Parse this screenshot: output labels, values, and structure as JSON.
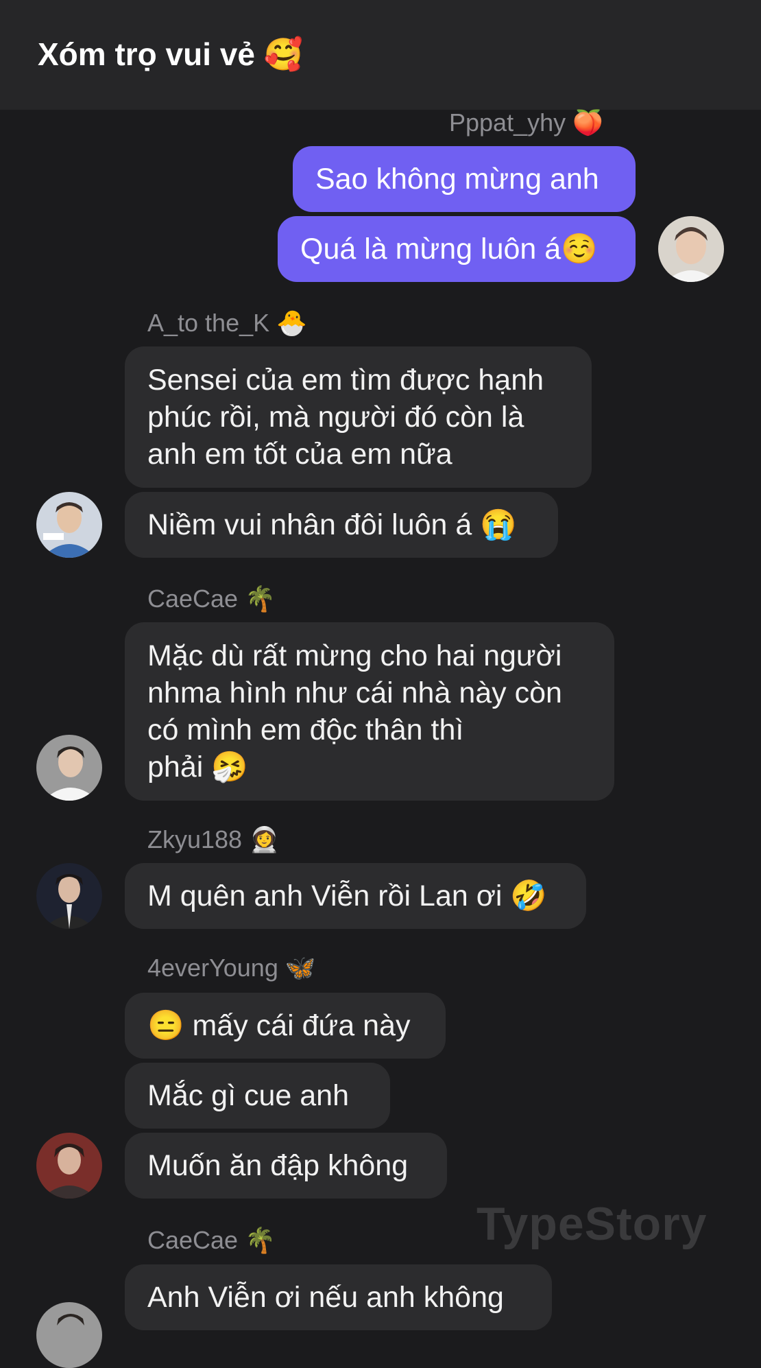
{
  "header": {
    "title": "Xóm trọ vui vẻ",
    "title_emoji": "🥰"
  },
  "messages": [
    {
      "sender": "Pppat_yhy",
      "sender_emoji": "🍑",
      "bubbles": [
        "Sao không mừng anh",
        "Quá là mừng luôn á☺️"
      ]
    },
    {
      "sender": "A_to the_K",
      "sender_emoji": "🐣",
      "bubbles": [
        "Sensei của em tìm được hạnh\nphúc rồi, mà người đó còn là\nanh em tốt của em nữa",
        "Niềm vui nhân đôi luôn á 😭"
      ]
    },
    {
      "sender": "CaeCae",
      "sender_emoji": "🌴",
      "bubbles": [
        "Mặc dù rất mừng cho hai người\nnhma hình như cái nhà này còn\ncó mình em độc thân thì\nphải 🤧"
      ]
    },
    {
      "sender": "Zkyu188",
      "sender_emoji": "👩‍🚀",
      "bubbles": [
        "M quên anh Viễn rồi Lan ơi 🤣"
      ]
    },
    {
      "sender": "4everYoung",
      "sender_emoji": "🦋",
      "bubbles": [
        "😑  mấy cái đứa này",
        "Mắc gì cue anh",
        "Muốn ăn đập không"
      ]
    },
    {
      "sender": "CaeCae",
      "sender_emoji": "🌴",
      "bubbles": [
        "Anh Viễn ơi nếu anh không"
      ]
    }
  ],
  "watermark": "TypeStory"
}
